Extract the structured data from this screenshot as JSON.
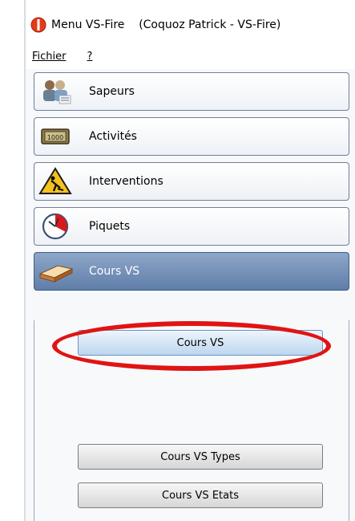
{
  "window": {
    "title": "Menu VS-Fire    (Coquoz Patrick - VS-Fire)"
  },
  "menu": {
    "items": [
      "Fichier",
      "?"
    ]
  },
  "nav": {
    "items": [
      {
        "label": "Sapeurs",
        "icon": "firefighters-icon"
      },
      {
        "label": "Activités",
        "icon": "money-icon"
      },
      {
        "label": "Interventions",
        "icon": "road-work-warning-icon"
      },
      {
        "label": "Piquets",
        "icon": "clock-icon"
      },
      {
        "label": "Cours VS",
        "icon": "book-icon",
        "active": true
      }
    ]
  },
  "sub": {
    "buttons": [
      {
        "label": "Cours VS",
        "selected": true
      },
      {
        "label": "Cours VS Types"
      },
      {
        "label": "Cours VS Etats"
      }
    ]
  },
  "colors": {
    "accent": "#5f7ea9",
    "highlight": "#e01414"
  }
}
